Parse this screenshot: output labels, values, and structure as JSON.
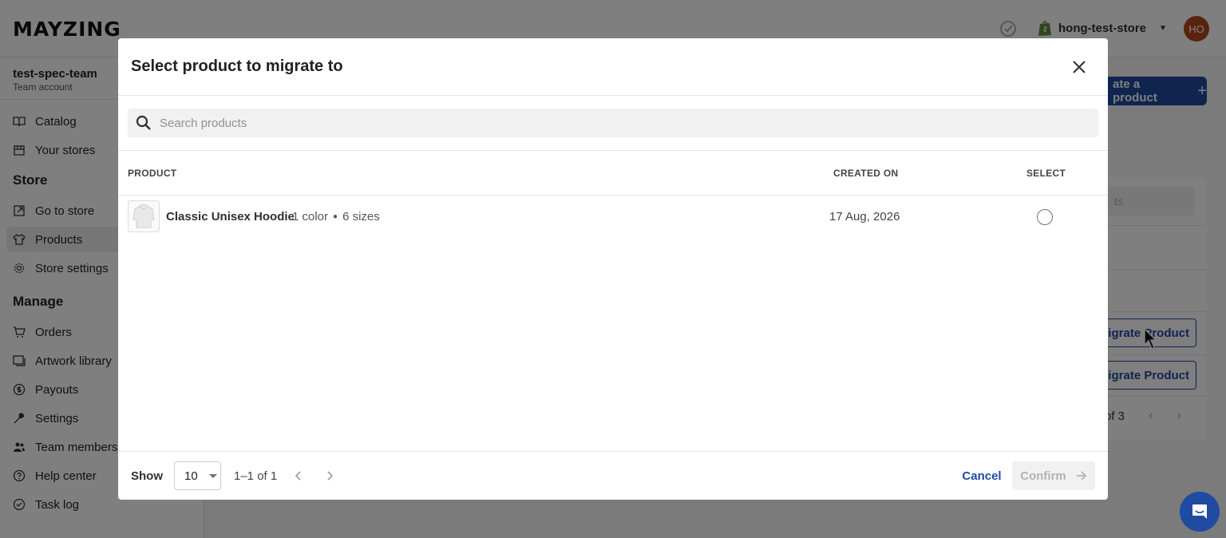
{
  "app": {
    "logo": "MAYZING",
    "store_name": "hong-test-store",
    "avatar_initials": "HO"
  },
  "sidebar": {
    "team_name": "test-spec-team",
    "team_sub": "Team account",
    "items_top": [
      {
        "label": "Catalog",
        "icon": "book-icon"
      },
      {
        "label": "Your stores",
        "icon": "store-icon"
      }
    ],
    "store_section": "Store",
    "store_items": [
      {
        "label": "Go to store",
        "icon": "external-link-icon"
      },
      {
        "label": "Products",
        "icon": "shirt-icon",
        "active": true
      },
      {
        "label": "Store settings",
        "icon": "gear-icon"
      }
    ],
    "manage_section": "Manage",
    "manage_items": [
      {
        "label": "Orders",
        "icon": "cart-icon"
      },
      {
        "label": "Artwork library",
        "icon": "image-icon"
      },
      {
        "label": "Payouts",
        "icon": "dollar-circle-icon"
      },
      {
        "label": "Settings",
        "icon": "wrench-icon"
      },
      {
        "label": "Team members",
        "icon": "users-icon"
      },
      {
        "label": "Help center",
        "icon": "help-circle-icon"
      },
      {
        "label": "Task log",
        "icon": "check-circle-icon"
      }
    ]
  },
  "background": {
    "create_button": "ate a product",
    "search_partial": "ts",
    "migrate_button_1": "Migrate Product",
    "migrate_button_2": "Migrate Product",
    "pager_text": "of 3"
  },
  "modal": {
    "title": "Select product to migrate to",
    "search_placeholder": "Search products",
    "columns": {
      "product": "PRODUCT",
      "created_on": "CREATED ON",
      "select": "SELECT"
    },
    "rows": [
      {
        "name": "Classic Unisex Hoodie",
        "colors": "1 color",
        "sizes": "6 sizes",
        "created_on": "17 Aug, 2026",
        "selected": false
      }
    ],
    "footer": {
      "show_label": "Show",
      "page_size": "10",
      "range": "1–1 of 1",
      "cancel": "Cancel",
      "confirm": "Confirm"
    }
  },
  "colors": {
    "accent": "#1f4ba0",
    "avatar": "#b5451b"
  }
}
